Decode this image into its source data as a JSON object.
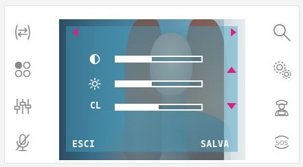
{
  "left_icons": [
    {
      "icon": "swap-arrows-icon"
    },
    {
      "icon": "dots-grid-icon"
    },
    {
      "icon": "sliders-icon"
    },
    {
      "icon": "mic-off-icon"
    }
  ],
  "right_icons": [
    {
      "icon": "search-icon"
    },
    {
      "icon": "gears-icon"
    },
    {
      "icon": "guard-icon"
    },
    {
      "icon": "sos-icon",
      "label": "SOS"
    }
  ],
  "overlay": {
    "sliders": [
      {
        "icon": "contrast-icon",
        "label": "",
        "fraction": 0.42
      },
      {
        "icon": "brightness-icon",
        "label": "",
        "fraction": 0.42
      },
      {
        "icon": "color-icon",
        "label": "CL",
        "fraction": 0.5
      }
    ],
    "exit_label": "ESCI",
    "save_label": "SALVA"
  },
  "colors": {
    "accent": "#e0207a",
    "icon_gray": "#8a8a8a",
    "overlay_text": "#ffffff"
  }
}
